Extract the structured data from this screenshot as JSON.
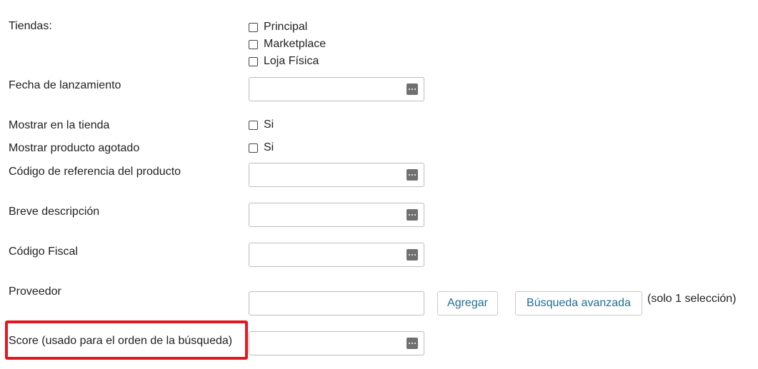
{
  "form": {
    "tiendas": {
      "label": "Tiendas:",
      "options": [
        {
          "label": "Principal",
          "checked": false
        },
        {
          "label": "Marketplace",
          "checked": false
        },
        {
          "label": "Loja Física",
          "checked": false
        }
      ]
    },
    "fecha_lanzamiento": {
      "label": "Fecha de lanzamiento",
      "value": ""
    },
    "mostrar_tienda": {
      "label": "Mostrar en la tienda",
      "option_label": "Si",
      "checked": false
    },
    "mostrar_agotado": {
      "label": "Mostrar producto agotado",
      "option_label": "Si",
      "checked": false
    },
    "codigo_referencia": {
      "label": "Código de referencia del producto",
      "value": ""
    },
    "breve_descripcion": {
      "label": "Breve descripción",
      "value": ""
    },
    "codigo_fiscal": {
      "label": "Código Fiscal",
      "value": ""
    },
    "proveedor": {
      "label": "Proveedor",
      "value": "",
      "add_button": "Agregar",
      "advanced_button": "Búsqueda avanzada",
      "note": "(solo 1 selección)"
    },
    "score": {
      "label": "Score (usado para el orden de la búsqueda)",
      "value": ""
    }
  },
  "icons": {
    "field_action": "more-dots-icon"
  },
  "colors": {
    "highlight": "#e4161e",
    "button_text": "#1f6f96",
    "field_border": "#b9bcc0"
  }
}
